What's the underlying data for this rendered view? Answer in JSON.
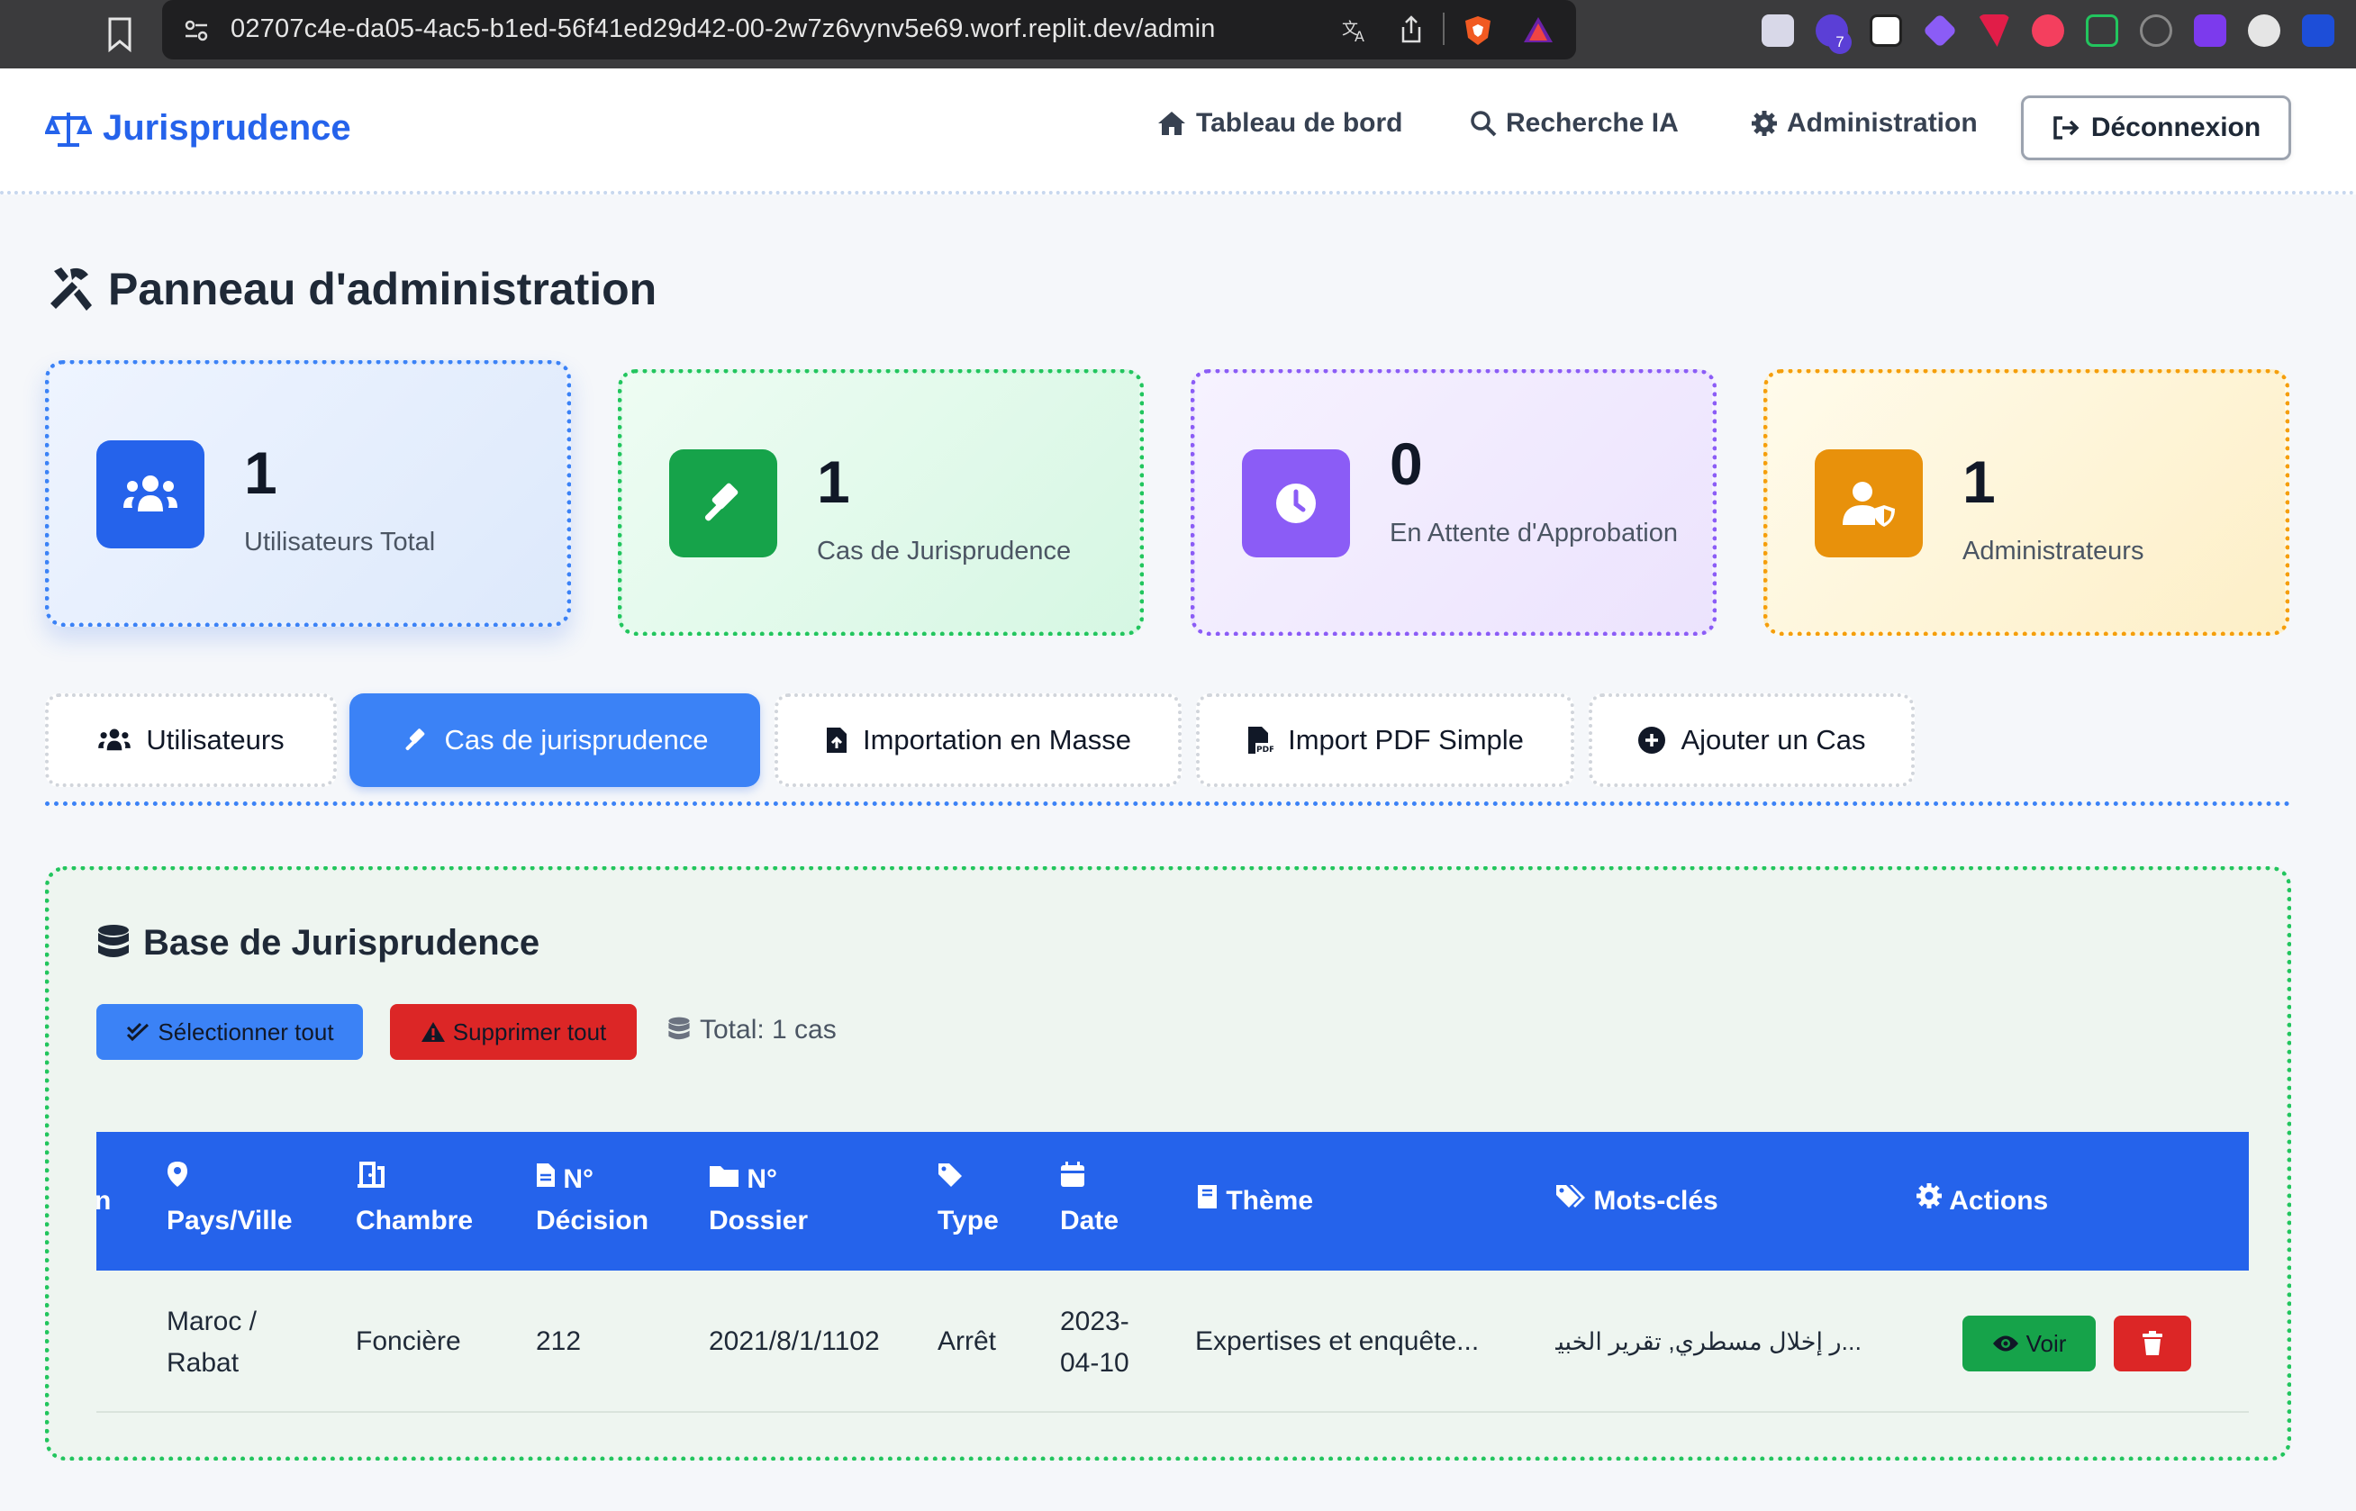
{
  "browser": {
    "url": "02707c4e-da05-4ac5-b1ed-56f41ed29d42-00-2w7z6vynv5e69.worf.replit.dev/admin",
    "extension_badge": "7"
  },
  "header": {
    "brand": "Jurisprudence",
    "nav": [
      {
        "label": "Tableau de bord",
        "icon": "home-icon"
      },
      {
        "label": "Recherche IA",
        "icon": "search-icon"
      },
      {
        "label": "Administration",
        "icon": "gear-icon"
      }
    ],
    "logout_label": "Déconnexion"
  },
  "page": {
    "title": "Panneau d'administration"
  },
  "stats": [
    {
      "value": "1",
      "label": "Utilisateurs Total",
      "icon": "users-icon",
      "color": "#2563eb"
    },
    {
      "value": "1",
      "label": "Cas de Jurisprudence",
      "icon": "gavel-icon",
      "color": "#16a34a"
    },
    {
      "value": "0",
      "label": "En Attente d'Approbation",
      "icon": "clock-icon",
      "color": "#8b5cf6"
    },
    {
      "value": "1",
      "label": "Administrateurs",
      "icon": "user-shield-icon",
      "color": "#f59e0b"
    }
  ],
  "tabs": [
    {
      "label": "Utilisateurs",
      "icon": "users-icon",
      "active": false
    },
    {
      "label": "Cas de jurisprudence",
      "icon": "gavel-icon",
      "active": true
    },
    {
      "label": "Importation en Masse",
      "icon": "file-upload-icon",
      "active": false
    },
    {
      "label": "Import PDF Simple",
      "icon": "file-pdf-icon",
      "active": false
    },
    {
      "label": "Ajouter un Cas",
      "icon": "plus-circle-icon",
      "active": false
    }
  ],
  "panel": {
    "title": "Base de Jurisprudence",
    "select_all": "Sélectionner tout",
    "delete_all": "Supprimer tout",
    "total": "Total: 1 cas"
  },
  "table": {
    "columns": {
      "pays": "Pays/Ville",
      "chambre": "Chambre",
      "n1": "N°",
      "decision": "Décision",
      "n2": "N°",
      "dossier": "Dossier",
      "type": "Type",
      "date": "Date",
      "theme": "Thème",
      "motscles": "Mots-clés",
      "actions": "Actions",
      "cut": "n"
    },
    "rows": [
      {
        "pays_1": "Maroc /",
        "pays_2": "Rabat",
        "chambre": "Foncière",
        "decision": "212",
        "dossier": "2021/8/1/1102",
        "type": "Arrêt",
        "date_1": "2023-",
        "date_2": "04-10",
        "theme": "Expertises et enquête...",
        "motscles": "...ر إخلال مسطري, تقرير الخبير,",
        "view_label": "Voir"
      }
    ]
  }
}
